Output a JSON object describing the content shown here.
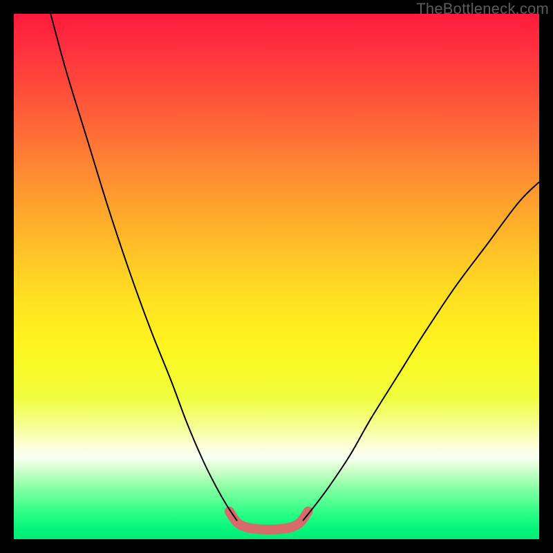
{
  "watermark": "TheBottleneck.com",
  "chart_data": {
    "type": "line",
    "title": "",
    "xlabel": "",
    "ylabel": "",
    "xlim": [
      0,
      100
    ],
    "ylim": [
      0,
      100
    ],
    "series": [
      {
        "name": "left-curve",
        "color": "#000000",
        "stroke_width": 2,
        "x": [
          7,
          10,
          14,
          18,
          22,
          26,
          30,
          33,
          36,
          38.5,
          40.5,
          42.5
        ],
        "y": [
          100,
          89,
          76,
          63,
          51,
          40,
          30,
          22,
          15,
          10,
          6.5,
          3.5
        ]
      },
      {
        "name": "right-curve",
        "color": "#000000",
        "stroke_width": 2,
        "x": [
          55,
          57,
          60,
          64,
          68,
          73,
          78,
          84,
          90,
          96,
          100
        ],
        "y": [
          3.5,
          6,
          10,
          16,
          23,
          31,
          39,
          48,
          56,
          64,
          68
        ]
      },
      {
        "name": "valley-highlight",
        "color": "#d76a6a",
        "stroke_width": 14,
        "linecap": "round",
        "x": [
          41,
          42.5,
          44.5,
          47,
          50,
          52.5,
          54.5,
          56
        ],
        "y": [
          5.3,
          3.2,
          2.2,
          1.9,
          1.9,
          2.2,
          3.2,
          5.3
        ]
      }
    ]
  }
}
